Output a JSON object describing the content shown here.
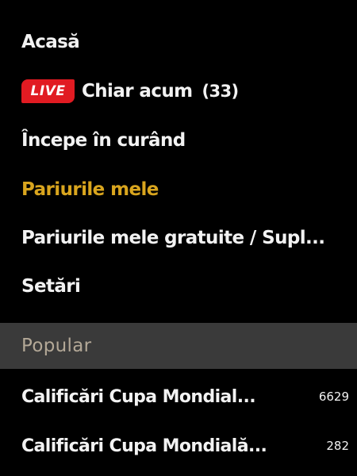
{
  "nav": {
    "home": "Acasă",
    "live_badge": "LIVE",
    "live_label": "Chiar acum",
    "live_count": "(33)",
    "starting_soon": "Începe în curând",
    "my_bets": "Pariurile mele",
    "my_free_bets": "Pariurile mele gratuite / Supl...",
    "settings": "Setări"
  },
  "popular": {
    "header": "Popular",
    "items": [
      {
        "label": "Calificări Cupa Mondial...",
        "count": "6629"
      },
      {
        "label": "Calificări Cupa Mondială...",
        "count": "282"
      }
    ]
  },
  "colors": {
    "background": "#000000",
    "text": "#f2f2f2",
    "active": "#d9a51e",
    "live": "#e11b22",
    "section_bg": "#3a3a3a",
    "section_text": "#b3a897"
  }
}
